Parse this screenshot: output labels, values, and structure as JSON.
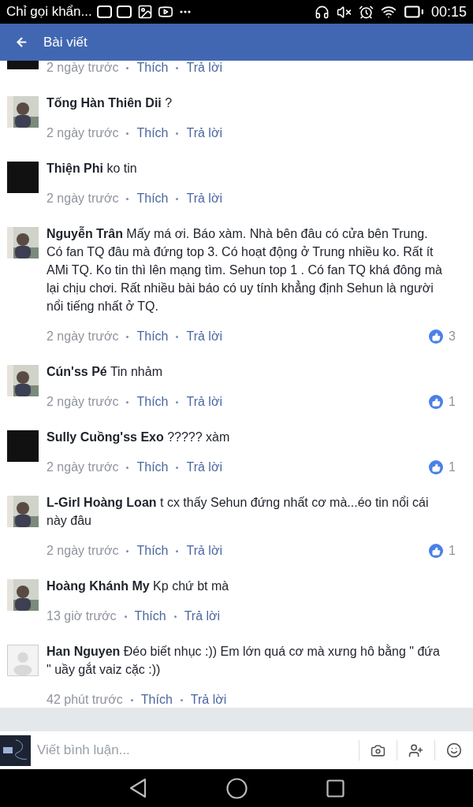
{
  "status_bar": {
    "notification": "Chỉ gọi khẩn...",
    "time": "00:15"
  },
  "header": {
    "title": "Bài viết"
  },
  "comments": [
    {
      "kind": "dark",
      "partial": true,
      "time": "2 ngày trước",
      "like": "Thích",
      "reply": "Trả lời"
    },
    {
      "body": "**Tống Hàn Thiên Dii** ?",
      "time": "2 ngày trước",
      "like": "Thích",
      "reply": "Trả lời"
    },
    {
      "kind": "dark",
      "body": "**Thiện Phi** ko tin",
      "time": "2 ngày trước",
      "like": "Thích",
      "reply": "Trả lời"
    },
    {
      "body": "**Nguyễn Trân** Mấy má ơi. Báo xàm. Nhà bên đâu có cửa bên Trung. Có fan TQ đâu mà đứng top 3. Có hoạt động ở Trung nhiều ko.  Rất ít AMi TQ. Ko tin thì lên mạng tìm. Sehun top 1 . Có fan TQ khá đông mà lại chịu chơi. Rất nhiều bài báo có uy tính khẳng định Sehun là người nổi tiếng nhất ở TQ.",
      "time": "2 ngày trước",
      "like": "Thích",
      "reply": "Trả lời",
      "reactions": "3"
    },
    {
      "body": "**Cún'ss Pé** Tin nhảm",
      "time": "2 ngày trước",
      "like": "Thích",
      "reply": "Trả lời",
      "reactions": "1"
    },
    {
      "kind": "dark",
      "body": "**Sully Cuồng'ss Exo** ????? xàm",
      "time": "2 ngày trước",
      "like": "Thích",
      "reply": "Trả lời",
      "reactions": "1"
    },
    {
      "body": "**L-Girl Hoàng Loan** t cx thấy Sehun đứng nhất cơ mà...éo tin nổi cái này đâu",
      "time": "2 ngày trước",
      "like": "Thích",
      "reply": "Trả lời",
      "reactions": "1"
    },
    {
      "body": "**Hoàng Khánh My** Kp chứ bt mà",
      "time": "13 giờ trước",
      "like": "Thích",
      "reply": "Trả lời"
    },
    {
      "kind": "blank",
      "body": "**Han Nguyen** Đéo biết nhục :)) Em lớn quá cơ mà xưng hô bằng \" đứa \" uầy gắt vaiz cặc :))",
      "time": "42 phút trước",
      "like": "Thích",
      "reply": "Trả lời"
    }
  ],
  "composer": {
    "placeholder": "Viết bình luận..."
  }
}
